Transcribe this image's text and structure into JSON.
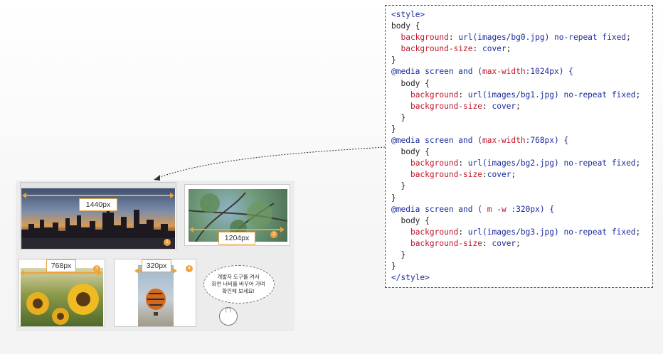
{
  "code": {
    "lines": [
      [
        {
          "t": "<style>",
          "c": "tag"
        }
      ],
      [
        {
          "t": "body {"
        }
      ],
      [
        {
          "t": "  "
        },
        {
          "t": "background",
          "c": "prop"
        },
        {
          "t": ": "
        },
        {
          "t": "url(images/bg0.jpg) no-repeat fixed",
          "c": "val"
        },
        {
          "t": ";"
        }
      ],
      [
        {
          "t": "  "
        },
        {
          "t": "background-size",
          "c": "prop"
        },
        {
          "t": ": "
        },
        {
          "t": "cover",
          "c": "val"
        },
        {
          "t": ";"
        }
      ],
      [
        {
          "t": "}"
        }
      ],
      [
        {
          "t": "@media screen and (",
          "c": "val"
        },
        {
          "t": "max-width",
          "c": "prop"
        },
        {
          "t": ":1024px) {",
          "c": "val"
        }
      ],
      [
        {
          "t": "  body {"
        }
      ],
      [
        {
          "t": "    "
        },
        {
          "t": "background",
          "c": "prop"
        },
        {
          "t": ": "
        },
        {
          "t": "url(images/bg1.jpg) no-repeat fixed",
          "c": "val"
        },
        {
          "t": ";"
        }
      ],
      [
        {
          "t": "    "
        },
        {
          "t": "background-size",
          "c": "prop"
        },
        {
          "t": ": "
        },
        {
          "t": "cover",
          "c": "val"
        },
        {
          "t": ";"
        }
      ],
      [
        {
          "t": "  }"
        }
      ],
      [
        {
          "t": "}"
        }
      ],
      [
        {
          "t": "@media screen and (",
          "c": "val"
        },
        {
          "t": "max-width",
          "c": "prop"
        },
        {
          "t": ":768px) {",
          "c": "val"
        }
      ],
      [
        {
          "t": "  body {"
        }
      ],
      [
        {
          "t": "    "
        },
        {
          "t": "background",
          "c": "prop"
        },
        {
          "t": ": "
        },
        {
          "t": "url(images/bg2.jpg) no-repeat fixed",
          "c": "val"
        },
        {
          "t": ";"
        }
      ],
      [
        {
          "t": "    "
        },
        {
          "t": "background-size",
          "c": "prop"
        },
        {
          "t": ":"
        },
        {
          "t": "cover",
          "c": "val"
        },
        {
          "t": ";"
        }
      ],
      [
        {
          "t": "  }"
        }
      ],
      [
        {
          "t": "}"
        }
      ],
      [
        {
          "t": "@media screen and ( ",
          "c": "val"
        },
        {
          "t": "m",
          "c": "prop"
        },
        {
          "t": " -",
          "c": "val"
        },
        {
          "t": "w",
          "c": "prop"
        },
        {
          "t": " :320px) {",
          "c": "val"
        }
      ],
      [
        {
          "t": "  body {"
        }
      ],
      [
        {
          "t": "    "
        },
        {
          "t": "background",
          "c": "prop"
        },
        {
          "t": ": "
        },
        {
          "t": "url(images/bg3.jpg) no-repeat fixed",
          "c": "val"
        },
        {
          "t": ";"
        }
      ],
      [
        {
          "t": "    "
        },
        {
          "t": "background-size",
          "c": "prop"
        },
        {
          "t": ": "
        },
        {
          "t": "cover",
          "c": "val"
        },
        {
          "t": ";"
        }
      ],
      [
        {
          "t": "  }"
        }
      ],
      [
        {
          "t": "}"
        }
      ],
      [
        {
          "t": "</style>",
          "c": "tag"
        }
      ]
    ]
  },
  "preview": {
    "shot1": {
      "label": "1440px",
      "num": "1"
    },
    "shot2": {
      "label": "1204px",
      "num": "2"
    },
    "shot3": {
      "label": "768px",
      "num": "3"
    },
    "shot4": {
      "label": "320px",
      "num": "4"
    },
    "bubble_lines": [
      "개발자 도구를 켜서",
      "화면 너비를 바꾸어 가며",
      "확인해 보세요!"
    ],
    "character_text": "(' ')"
  },
  "colors": {
    "accent": "#f0a23a",
    "code_blue": "#1a2b9c",
    "code_red": "#c0172b"
  }
}
